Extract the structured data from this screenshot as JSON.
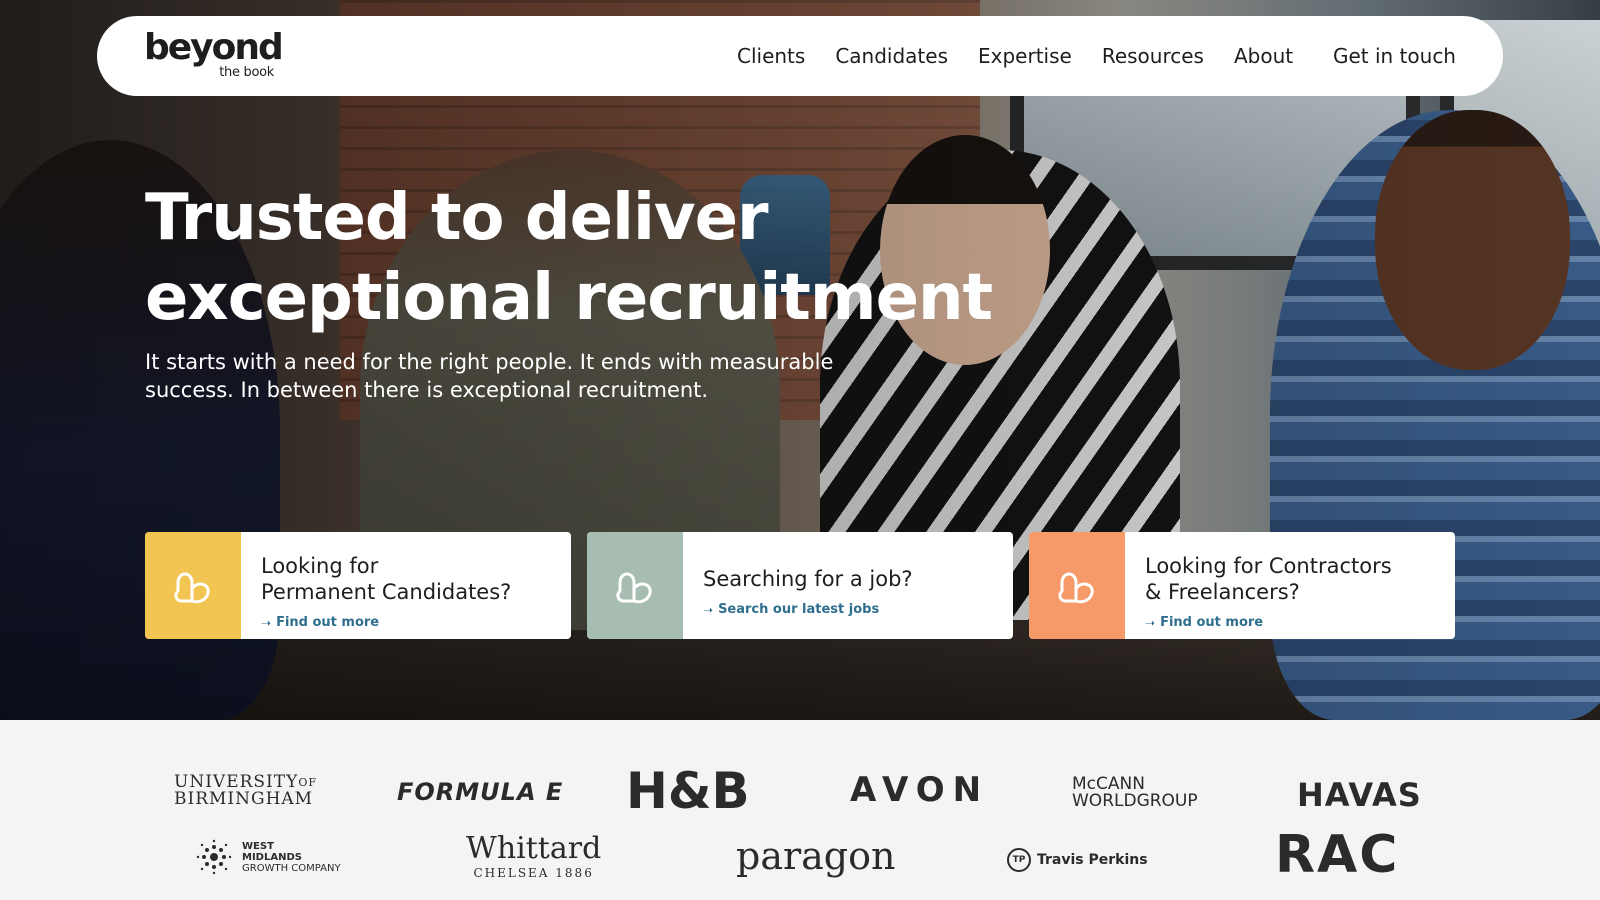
{
  "brand": {
    "name": "beyond",
    "tagline": "the book"
  },
  "nav": {
    "links": [
      "Clients",
      "Candidates",
      "Expertise",
      "Resources",
      "About"
    ],
    "cta": "Get in touch"
  },
  "hero": {
    "title_line1": "Trusted to deliver",
    "title_line2": "exceptional recruitment",
    "subtitle": "It starts with a need for the right people. It ends with measurable success. In between there is exceptional recruitment."
  },
  "cards": [
    {
      "title_line1": "Looking for",
      "title_line2": "Permanent Candidates?",
      "link": "Find out more",
      "icon": "heart-outline-icon",
      "color": "#f2c553"
    },
    {
      "title_line1": "Searching for a job?",
      "title_line2": "",
      "link": "Search our latest jobs",
      "icon": "heart-outline-icon",
      "color": "#a8bdb2"
    },
    {
      "title_line1": "Looking for Contractors",
      "title_line2": "& Freelancers?",
      "link": "Find out more",
      "icon": "heart-outline-icon",
      "color": "#f79a6a"
    }
  ],
  "client_logos": {
    "university": [
      "UNIVERSITY",
      "OF",
      "BIRMINGHAM"
    ],
    "formula": "FORMULA E",
    "hb": "H&B",
    "avon": "AVON",
    "mccann": [
      "McCANN",
      "WORLDGROUP"
    ],
    "havas": "HAVAS",
    "wmgc": [
      "WEST",
      "MIDLANDS",
      "GROWTH COMPANY"
    ],
    "whittard": [
      "Whittard",
      "CHELSEA 1886"
    ],
    "paragon": "paragon",
    "travis_badge": "TP",
    "travis": "Travis Perkins",
    "rac": "RAC"
  },
  "colors": {
    "link": "#2f6e8e",
    "card_yellow": "#f2c553",
    "card_sage": "#a8bdb2",
    "card_orange": "#f79a6a"
  }
}
